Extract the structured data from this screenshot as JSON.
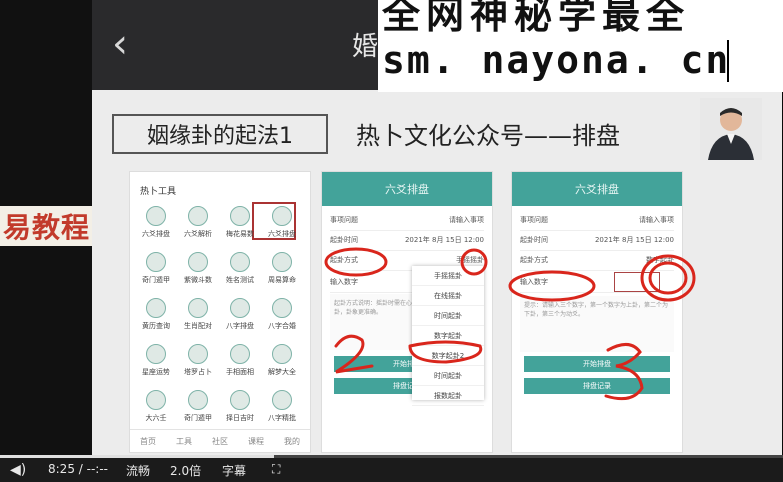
{
  "overlay": {
    "line1": "全网神秘学最全",
    "line2": "sm. nayona. cn"
  },
  "left_banner": "易教程",
  "topbar": {
    "back_glyph": "‹",
    "title": "婚"
  },
  "slide": {
    "box_title": "姻缘卦的起法1",
    "heading": "热卜文化公众号——排盘"
  },
  "phone1": {
    "title": "热卜工具",
    "tools": [
      "六爻排盘",
      "六爻解析",
      "梅花易数",
      "六爻排盘",
      "奇门遁甲",
      "紫微斗数",
      "姓名测试",
      "周易算命",
      "黄历查询",
      "生肖配对",
      "八字排盘",
      "八字合婚",
      "星座运势",
      "塔罗占卜",
      "手相面相",
      "解梦大全",
      "大六壬",
      "奇门遁甲",
      "择日吉时",
      "八字精批"
    ],
    "nav": [
      "首页",
      "工具",
      "社区",
      "课程",
      "我的"
    ]
  },
  "phone2": {
    "title": "六爻排盘",
    "rows": [
      [
        "事项问题",
        "请输入事项"
      ],
      [
        "起卦时间",
        "2021年 8月 15日 12:00"
      ],
      [
        "起卦方式",
        "手摇摇卦"
      ]
    ],
    "input_label": "输入数字",
    "hint": "起卦方式说明：摇卦时需在心中默念所问之事，诚心起卦，卦象更准确。",
    "buttons": [
      "开始排盘",
      "排盘记录"
    ],
    "dropdown": [
      "手摇摇卦",
      "在线摇卦",
      "时间起卦",
      "数字起卦",
      "数字起卦2",
      "时间起卦",
      "报数起卦"
    ]
  },
  "phone3": {
    "title": "六爻排盘",
    "rows": [
      [
        "事项问题",
        "请输入事项"
      ],
      [
        "起卦时间",
        "2021年 8月 15日 12:00"
      ],
      [
        "起卦方式",
        "数字起卦"
      ]
    ],
    "input_label": "输入数字",
    "hint": "提示：请输入三个数字，第一个数字为上卦，第二个为下卦，第三个为动爻。",
    "buttons": [
      "开始排盘",
      "排盘记录"
    ]
  },
  "player": {
    "time": "8:25 / --:--",
    "quality": "流畅",
    "speed": "2.0倍",
    "subtitle": "字幕",
    "progress_percent": 35
  },
  "colors": {
    "accent": "#43a39a",
    "annotation": "#d9261c"
  }
}
